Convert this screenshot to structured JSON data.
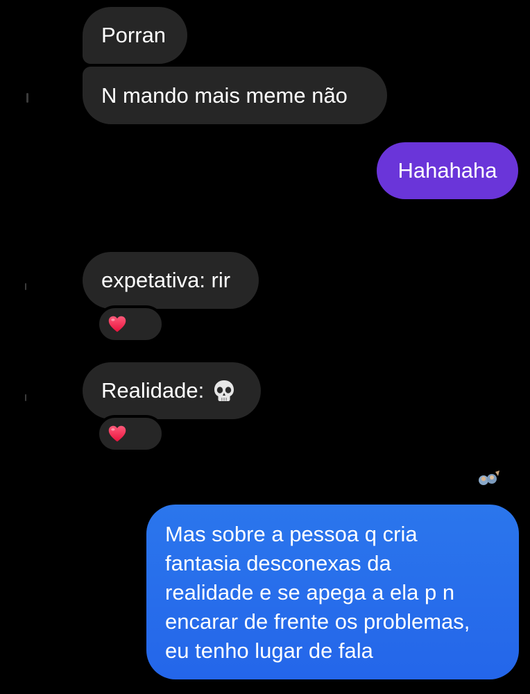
{
  "messages": {
    "incoming_1": "Porran",
    "incoming_2": "N mando mais meme não",
    "outgoing_1": "Hahahaha",
    "incoming_3": "expetativa: rir",
    "incoming_4": "Realidade:",
    "outgoing_2_lines": [
      "Mas sobre a pessoa q cria",
      "fantasia desconexas da",
      "realidade e se apega a ela p n",
      "encarar de frente os problemas,",
      "eu tenho lugar de fala"
    ]
  },
  "reactions": {
    "reaction_1": "heart-icon",
    "reaction_2": "heart-icon"
  },
  "icons": {
    "skull": "skull-icon",
    "seen": "seen-avatar-icon"
  },
  "colors": {
    "background": "#000000",
    "incoming_bubble": "#262626",
    "outgoing_purple": "#6a35d9",
    "outgoing_blue": "#2b76ec",
    "heart": "#ff2d55"
  }
}
